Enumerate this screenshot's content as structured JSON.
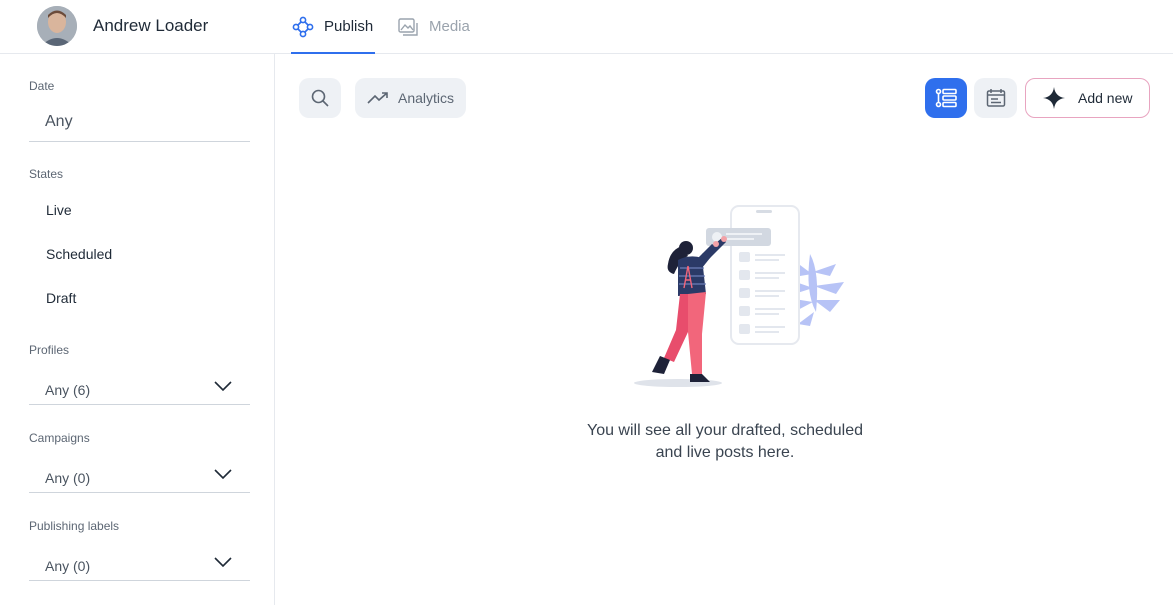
{
  "header": {
    "user_name": "Andrew Loader",
    "tabs": [
      {
        "label": "Publish",
        "active": true,
        "icon": "publish-icon"
      },
      {
        "label": "Media",
        "active": false,
        "icon": "media-icon"
      }
    ]
  },
  "sidebar": {
    "date": {
      "label": "Date",
      "value": "Any"
    },
    "states": {
      "label": "States",
      "items": [
        "Live",
        "Scheduled",
        "Draft"
      ]
    },
    "profiles": {
      "label": "Profiles",
      "value": "Any (6)"
    },
    "campaigns": {
      "label": "Campaigns",
      "value": "Any (0)"
    },
    "publishing_labels": {
      "label": "Publishing labels",
      "value": "Any (0)"
    }
  },
  "toolbar": {
    "analytics_label": "Analytics",
    "add_new_label": "Add new"
  },
  "empty_state": {
    "line1": "You will see all your drafted, scheduled",
    "line2": "and live posts here."
  },
  "colors": {
    "accent": "#2f6fed",
    "add_border": "#e8a4c0",
    "illustration_pink": "#f2667b",
    "illustration_navy": "#2b3a67"
  }
}
